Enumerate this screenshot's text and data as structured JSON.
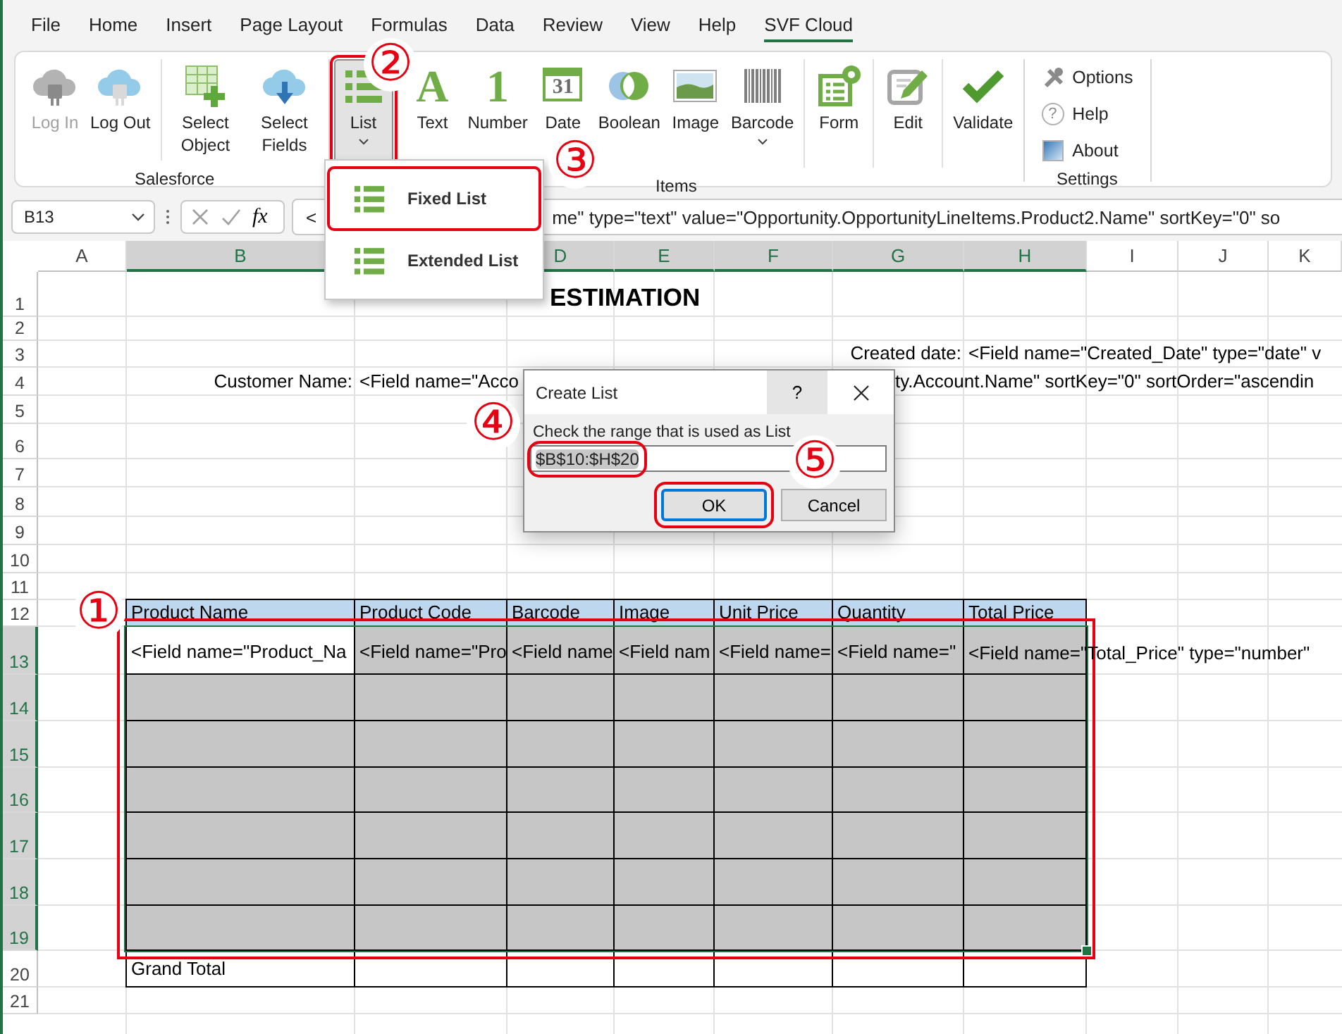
{
  "menu_tabs": [
    {
      "label": "File",
      "selected": false
    },
    {
      "label": "Home",
      "selected": false
    },
    {
      "label": "Insert",
      "selected": false
    },
    {
      "label": "Page Layout",
      "selected": false
    },
    {
      "label": "Formulas",
      "selected": false
    },
    {
      "label": "Data",
      "selected": false
    },
    {
      "label": "Review",
      "selected": false
    },
    {
      "label": "View",
      "selected": false
    },
    {
      "label": "Help",
      "selected": false
    },
    {
      "label": "SVF Cloud",
      "selected": true
    }
  ],
  "ribbon": {
    "groups": [
      {
        "label": "Salesforce",
        "sections": [
          [
            {
              "label": "Log In",
              "disabled": true,
              "pressed": false,
              "has_menu": false,
              "highlighted": false
            },
            {
              "label": "Log Out",
              "disabled": false,
              "pressed": false,
              "has_menu": false,
              "highlighted": false
            }
          ],
          [
            {
              "label": "Select Object",
              "disabled": false,
              "pressed": false,
              "has_menu": false,
              "highlighted": false
            },
            {
              "label": "Select Fields",
              "disabled": false,
              "pressed": false,
              "has_menu": false,
              "highlighted": false
            }
          ]
        ]
      },
      {
        "label": "Items",
        "sections": [
          [
            {
              "label": "List",
              "disabled": false,
              "pressed": true,
              "has_menu": true,
              "highlighted": true
            }
          ],
          [
            {
              "label": "Text",
              "glyph": "A",
              "disabled": false,
              "pressed": false,
              "has_menu": false,
              "highlighted": false
            },
            {
              "label": "Number",
              "glyph": "1",
              "disabled": false,
              "pressed": false,
              "has_menu": false,
              "highlighted": false
            },
            {
              "label": "Date",
              "glyph": "31",
              "disabled": false,
              "pressed": false,
              "has_menu": false,
              "highlighted": false
            },
            {
              "label": "Boolean",
              "disabled": false,
              "pressed": false,
              "has_menu": false,
              "highlighted": false
            },
            {
              "label": "Image",
              "disabled": false,
              "pressed": false,
              "has_menu": false,
              "highlighted": false
            },
            {
              "label": "Barcode",
              "disabled": false,
              "pressed": false,
              "has_menu": true,
              "highlighted": false
            }
          ],
          [
            {
              "label": "Form",
              "disabled": false,
              "pressed": false,
              "has_menu": false,
              "highlighted": false
            }
          ],
          [
            {
              "label": "Edit",
              "disabled": false,
              "pressed": false,
              "has_menu": false,
              "highlighted": false
            }
          ],
          [
            {
              "label": "Validate",
              "disabled": false,
              "pressed": false,
              "has_menu": false,
              "highlighted": false
            }
          ]
        ]
      },
      {
        "label": "Settings",
        "small_items": [
          {
            "label": "Options"
          },
          {
            "label": "Help",
            "glyph": "?"
          },
          {
            "label": "About"
          }
        ]
      }
    ]
  },
  "list_menu": {
    "items": [
      {
        "label": "Fixed List",
        "highlighted": true
      },
      {
        "label": "Extended List",
        "highlighted": false
      }
    ]
  },
  "formula_bar": {
    "name_box": "B13",
    "function_glyph": "fx",
    "formula_parts": [
      "<",
      "me\" type=\"text\" value=\"Opportunity.OpportunityLineItems.Product2.Name\" sortKey=\"0\" so"
    ]
  },
  "sheet": {
    "columns": [
      {
        "label": "A",
        "selected": false
      },
      {
        "label": "B",
        "selected": true
      },
      {},
      {
        "label": "D",
        "selected": true
      },
      {
        "label": "E",
        "selected": true
      },
      {
        "label": "F",
        "selected": true
      },
      {
        "label": "G",
        "selected": true
      },
      {
        "label": "H",
        "selected": true
      },
      {
        "label": "I",
        "selected": false
      },
      {
        "label": "J",
        "selected": false
      },
      {
        "label": "K",
        "selected": false
      }
    ],
    "range_frame": {
      "highlighted": true
    },
    "rows": [
      {
        "number": "1",
        "selected": false,
        "cells": [
          {},
          {},
          {},
          {
            "kind": "title",
            "text": "ESTIMATION"
          }
        ]
      },
      {
        "number": "2",
        "selected": false,
        "cells": []
      },
      {
        "number": "3",
        "selected": false,
        "cells": [
          {},
          {},
          {},
          {},
          {},
          {},
          {
            "kind": "label",
            "text": "Created date:"
          },
          {
            "kind": "text",
            "text": "<Field name=\"Created_Date\" type=\"date\" v"
          }
        ]
      },
      {
        "number": "4",
        "selected": false,
        "cells": [
          {},
          {
            "kind": "label",
            "text": "Customer Name:"
          },
          {
            "kind": "text",
            "text": "<Field name=\"Acco"
          },
          {},
          {},
          {},
          {
            "kind": "continued",
            "text": "ty.Account.Name\" sortKey=\"0\" sortOrder=\"ascendin"
          }
        ]
      },
      {
        "number": "5",
        "selected": false,
        "cells": []
      },
      {
        "number": "6",
        "selected": false,
        "cells": []
      },
      {
        "number": "7",
        "selected": false,
        "cells": []
      },
      {
        "number": "8",
        "selected": false,
        "cells": []
      },
      {
        "number": "9",
        "selected": false,
        "cells": []
      },
      {
        "number": "10",
        "selected": false,
        "cells": []
      },
      {
        "number": "11",
        "selected": false,
        "cells": []
      },
      {
        "number": "12",
        "selected": false,
        "cells": [
          {},
          {
            "kind": "header",
            "text": "Product Name"
          },
          {
            "kind": "header",
            "text": "Product Code"
          },
          {
            "kind": "header",
            "text": "Barcode"
          },
          {
            "kind": "header",
            "text": "Image"
          },
          {
            "kind": "header",
            "text": "Unit Price"
          },
          {
            "kind": "header",
            "text": "Quantity"
          },
          {
            "kind": "header",
            "text": "Total Price"
          }
        ]
      },
      {
        "number": "13",
        "selected": true,
        "cells": [
          {},
          {
            "kind": "active",
            "text": "<Field name=\"Product_Na"
          },
          {
            "kind": "list",
            "text": "<Field name=\"Pro"
          },
          {
            "kind": "list",
            "text": "<Field name"
          },
          {
            "kind": "list",
            "text": "<Field nam"
          },
          {
            "kind": "list",
            "text": "<Field name="
          },
          {
            "kind": "list",
            "text": "<Field name=\""
          },
          {
            "kind": "list",
            "text": "<Field name=\"Total_Price\" type=\"number\""
          }
        ]
      },
      {
        "number": "14",
        "selected": true,
        "cells": [
          {},
          {
            "kind": "list"
          },
          {
            "kind": "list"
          },
          {
            "kind": "list"
          },
          {
            "kind": "list"
          },
          {
            "kind": "list"
          },
          {
            "kind": "list"
          },
          {
            "kind": "list"
          }
        ]
      },
      {
        "number": "15",
        "selected": true,
        "cells": [
          {},
          {
            "kind": "list"
          },
          {
            "kind": "list"
          },
          {
            "kind": "list"
          },
          {
            "kind": "list"
          },
          {
            "kind": "list"
          },
          {
            "kind": "list"
          },
          {
            "kind": "list"
          }
        ]
      },
      {
        "number": "16",
        "selected": true,
        "cells": [
          {},
          {
            "kind": "list"
          },
          {
            "kind": "list"
          },
          {
            "kind": "list"
          },
          {
            "kind": "list"
          },
          {
            "kind": "list"
          },
          {
            "kind": "list"
          },
          {
            "kind": "list"
          }
        ]
      },
      {
        "number": "17",
        "selected": true,
        "cells": [
          {},
          {
            "kind": "list"
          },
          {
            "kind": "list"
          },
          {
            "kind": "list"
          },
          {
            "kind": "list"
          },
          {
            "kind": "list"
          },
          {
            "kind": "list"
          },
          {
            "kind": "list"
          }
        ]
      },
      {
        "number": "18",
        "selected": true,
        "cells": [
          {},
          {
            "kind": "list"
          },
          {
            "kind": "list"
          },
          {
            "kind": "list"
          },
          {
            "kind": "list"
          },
          {
            "kind": "list"
          },
          {
            "kind": "list"
          },
          {
            "kind": "list"
          }
        ]
      },
      {
        "number": "19",
        "selected": true,
        "cells": [
          {},
          {
            "kind": "list"
          },
          {
            "kind": "list"
          },
          {
            "kind": "list"
          },
          {
            "kind": "list"
          },
          {
            "kind": "list"
          },
          {
            "kind": "list"
          },
          {
            "kind": "list"
          }
        ]
      },
      {
        "number": "20",
        "selected": false,
        "cells": [
          {},
          {
            "kind": "total",
            "text": "Grand Total"
          },
          {
            "kind": "total"
          },
          {
            "kind": "total"
          },
          {
            "kind": "total"
          },
          {
            "kind": "total"
          },
          {
            "kind": "total"
          },
          {
            "kind": "total"
          }
        ]
      },
      {
        "number": "21",
        "selected": false,
        "cells": []
      }
    ]
  },
  "dialog": {
    "title": "Create List",
    "help_glyph": "?",
    "prompt": "Check the range that is used as List",
    "range_value": "$B$10:$H$20",
    "range_highlighted": true,
    "buttons": [
      {
        "label": "OK",
        "default": true,
        "highlighted": true
      },
      {
        "label": "Cancel",
        "default": false,
        "highlighted": false
      }
    ]
  },
  "annotations": [
    {
      "label": "①"
    },
    {
      "label": "②"
    },
    {
      "label": "③"
    },
    {
      "label": "④"
    },
    {
      "label": "⑤"
    }
  ]
}
